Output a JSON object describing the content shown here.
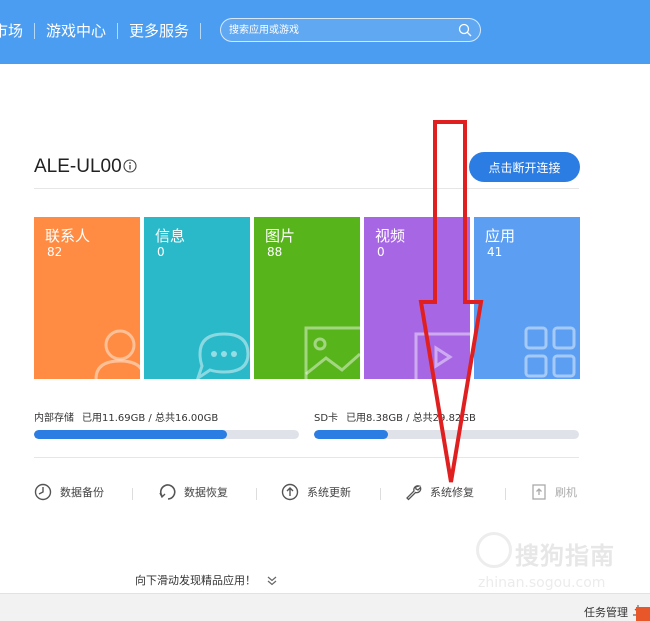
{
  "nav": {
    "items": [
      {
        "label": "市场",
        "display": "市场"
      },
      {
        "label": "游戏中心"
      },
      {
        "label": "更多服务"
      }
    ]
  },
  "search": {
    "placeholder": "搜索应用或游戏"
  },
  "device": {
    "name": "ALE-UL00",
    "disconnect_label": "点击断开连接"
  },
  "tiles": [
    {
      "label": "联系人",
      "count": "82",
      "color": "#ff8c42",
      "icon": "contact-icon"
    },
    {
      "label": "信息",
      "count": "0",
      "color": "#2ab9c8",
      "icon": "message-icon"
    },
    {
      "label": "图片",
      "count": "88",
      "color": "#58b41b",
      "icon": "picture-icon"
    },
    {
      "label": "视频",
      "count": "0",
      "color": "#a767e4",
      "icon": "video-icon"
    },
    {
      "label": "应用",
      "count": "41",
      "color": "#5b9ef2",
      "icon": "apps-icon"
    }
  ],
  "storage": {
    "internal": {
      "title": "内部存储",
      "detail": "已用11.69GB / 总共16.00GB",
      "used_fraction": 0.73
    },
    "sd": {
      "title": "SD卡",
      "detail": "已用8.38GB / 总共29.82GB",
      "used_fraction": 0.28
    }
  },
  "tools": [
    {
      "label": "数据备份",
      "icon": "backup-icon"
    },
    {
      "label": "数据恢复",
      "icon": "restore-icon"
    },
    {
      "label": "系统更新",
      "icon": "update-icon"
    },
    {
      "label": "系统修复",
      "icon": "wrench-icon"
    },
    {
      "label": "刷机",
      "icon": "flash-icon"
    }
  ],
  "scroll_hint": "向下滑动发现精品应用！",
  "bottom": {
    "task_manager": "任务管理"
  },
  "watermark": {
    "text": "搜狗指南",
    "url": "zhinan.sogou.com"
  },
  "colors": {
    "topbar": "#4a9df0",
    "accent": "#2b7de4",
    "arrow": "#e02020"
  }
}
